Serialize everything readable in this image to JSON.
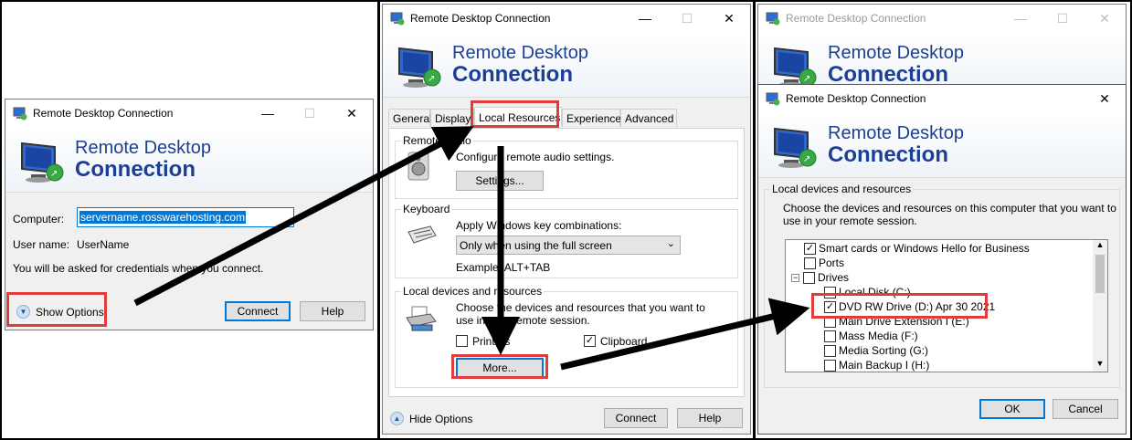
{
  "dialog1": {
    "title": "Remote Desktop Connection",
    "banner_line1": "Remote Desktop",
    "banner_line2": "Connection",
    "computer_label": "Computer:",
    "computer_value": "servername.rosswarehosting.com",
    "username_label": "User name:",
    "username_value": "UserName",
    "credentials_note": "You will be asked for credentials when you connect.",
    "show_options": "Show Options",
    "connect": "Connect",
    "help": "Help"
  },
  "dialog2": {
    "title": "Remote Desktop Connection",
    "banner_line1": "Remote Desktop",
    "banner_line2": "Connection",
    "tabs": [
      "General",
      "Display",
      "Local Resources",
      "Experience",
      "Advanced"
    ],
    "remote_audio": {
      "label": "Remote audio",
      "description": "Configure remote audio settings.",
      "settings_button": "Settings..."
    },
    "keyboard": {
      "label": "Keyboard",
      "description": "Apply Windows key combinations:",
      "select_value": "Only when using the full screen",
      "example": "Example: ALT+TAB"
    },
    "local_devices": {
      "label": "Local devices and resources",
      "description": "Choose the devices and resources that you want to use in your remote session.",
      "printers": "Printers",
      "printers_checked": false,
      "clipboard": "Clipboard",
      "clipboard_checked": true,
      "more_button": "More..."
    },
    "hide_options": "Hide Options",
    "connect": "Connect",
    "help": "Help"
  },
  "dialog3_back": {
    "title": "Remote Desktop Connection",
    "banner_line1": "Remote Desktop",
    "banner_line2": "Connection"
  },
  "dialog3": {
    "title": "Remote Desktop Connection",
    "banner_line1": "Remote Desktop",
    "banner_line2": "Connection",
    "group_label": "Local devices and resources",
    "description_line1": "Choose the devices and resources on this computer that you want to",
    "description_line2": "use in your remote session.",
    "tree": [
      {
        "label": "Smart cards or Windows Hello for Business",
        "checked": true,
        "indent": 0
      },
      {
        "label": "Ports",
        "checked": false,
        "indent": 0
      },
      {
        "label": "Drives",
        "checked": false,
        "indent": 0,
        "expander": "−"
      },
      {
        "label": "Local Disk (C:)",
        "checked": false,
        "indent": 1
      },
      {
        "label": "DVD RW Drive (D:) Apr 30 2021",
        "checked": true,
        "indent": 1
      },
      {
        "label": "Main Drive Extension I (E:)",
        "checked": false,
        "indent": 1
      },
      {
        "label": "Mass Media (F:)",
        "checked": false,
        "indent": 1
      },
      {
        "label": "Media Sorting (G:)",
        "checked": false,
        "indent": 1
      },
      {
        "label": "Main Backup I (H:)",
        "checked": false,
        "indent": 1
      }
    ],
    "ok": "OK",
    "cancel": "Cancel"
  },
  "colors": {
    "accent_blue": "#0078d7",
    "banner_text": "#1c3f94",
    "highlight_red": "#e03c3c",
    "selection": "#0078d7"
  },
  "icons": {
    "app": "remote-desktop-icon",
    "close": "close-icon",
    "minimize": "minimize-icon",
    "maximize": "maximize-icon",
    "expand": "chevron-down-icon",
    "collapse": "chevron-up-icon"
  }
}
